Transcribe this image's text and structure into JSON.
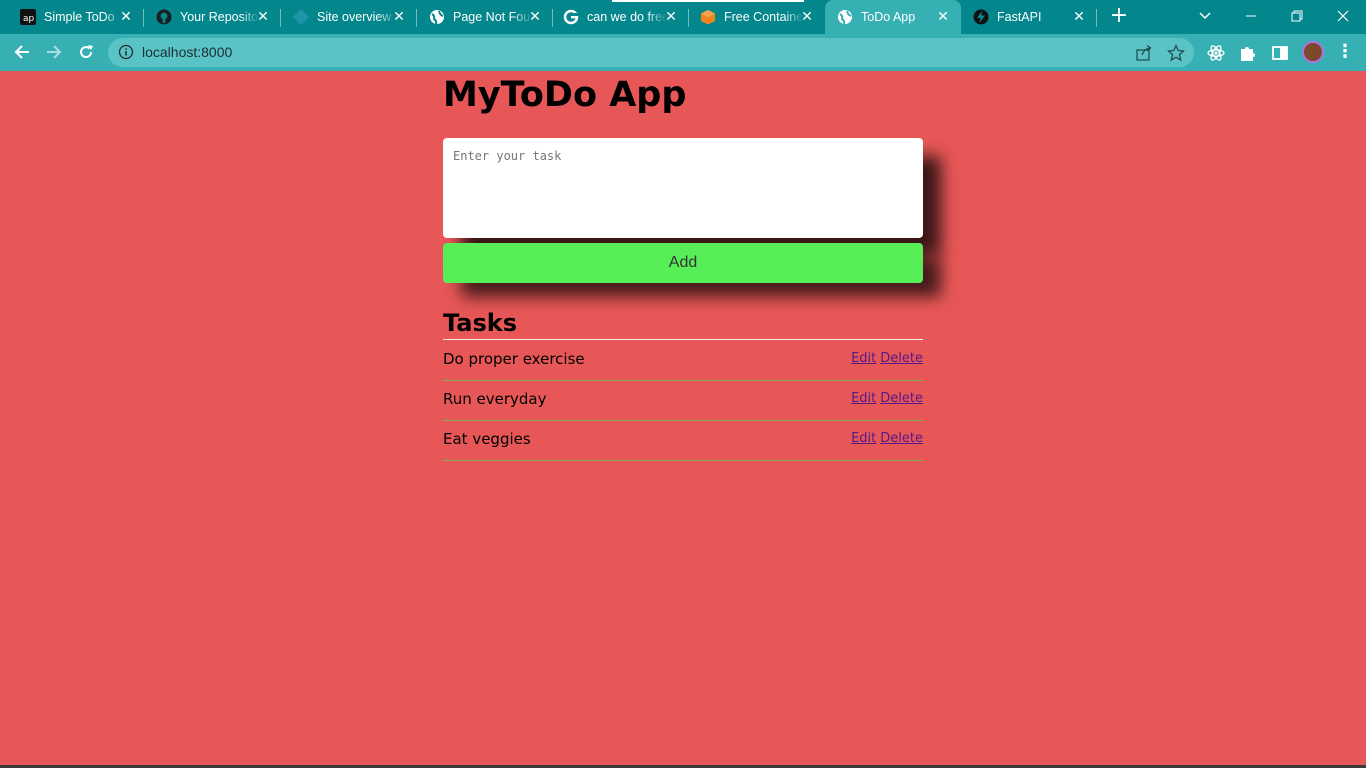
{
  "browser": {
    "tabs": [
      {
        "title": "Simple ToDo",
        "icon": "app-logo-icon",
        "active": false
      },
      {
        "title": "Your Repositories",
        "icon": "github-icon",
        "active": false
      },
      {
        "title": "Site overview",
        "icon": "netlify-icon",
        "active": false
      },
      {
        "title": "Page Not Found",
        "icon": "globe-icon",
        "active": false
      },
      {
        "title": "can we do free",
        "icon": "google-icon",
        "active": false
      },
      {
        "title": "Free Containers",
        "icon": "box-icon",
        "active": false
      },
      {
        "title": "ToDo App",
        "icon": "globe-icon",
        "active": true
      },
      {
        "title": "FastAPI",
        "icon": "fastapi-icon",
        "active": false
      }
    ],
    "address": "localhost:8000",
    "colors": {
      "tabbar": "#03868c",
      "toolbar": "#37b0b4",
      "omnibox": "#59c3c6"
    }
  },
  "page": {
    "title": "MyToDo App",
    "task_input_placeholder": "Enter your task",
    "add_label": "Add",
    "tasks_heading": "Tasks",
    "edit_label": "Edit",
    "delete_label": "Delete",
    "tasks": [
      {
        "text": "Do proper exercise"
      },
      {
        "text": "Run everyday"
      },
      {
        "text": "Eat veggies"
      }
    ],
    "colors": {
      "background": "#e85757",
      "add_button": "#57ee57",
      "link": "#551a8b"
    }
  }
}
